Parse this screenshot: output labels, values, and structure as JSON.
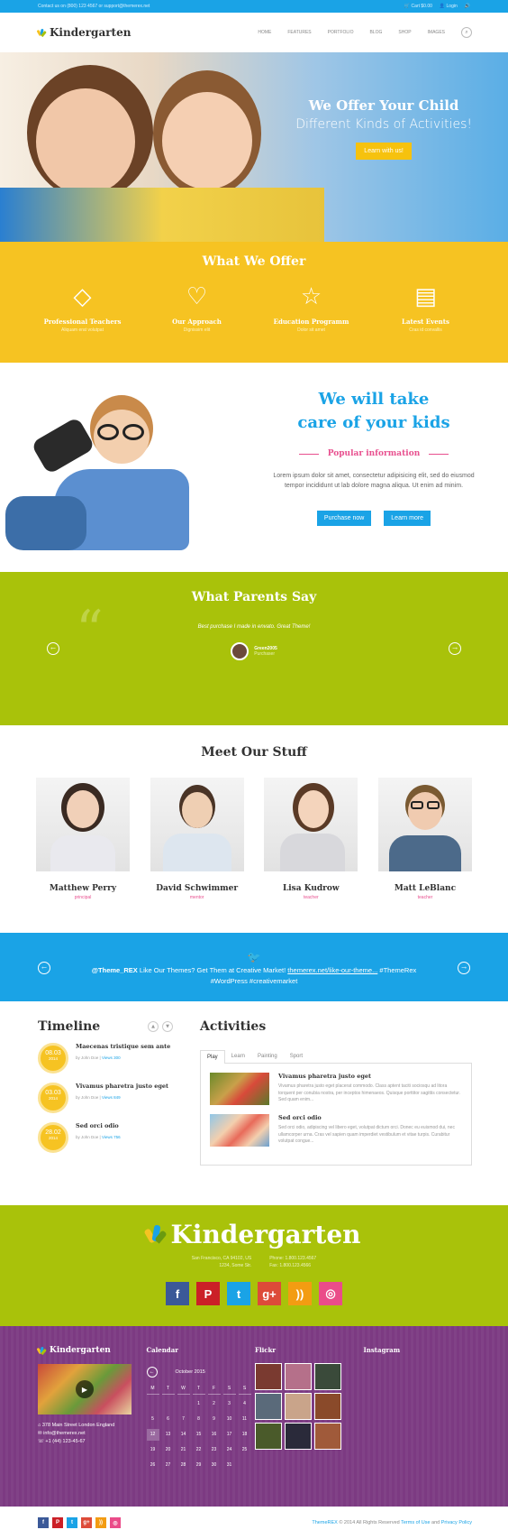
{
  "topbar": {
    "contact": "Contact us on (800) 123 4567 or support@themerex.net",
    "cart": "Cart $0.00",
    "login": "Login"
  },
  "header": {
    "logo": "Kindergarten",
    "nav": [
      "HOME",
      "FEATURES",
      "PORTFOLIO",
      "BLOG",
      "SHOP",
      "IMAGES"
    ]
  },
  "hero": {
    "title": "We Offer Your Child",
    "subtitle": "Different Kinds of Activities!",
    "button": "Learn with us!"
  },
  "offer": {
    "title": "What We Offer",
    "items": [
      {
        "icon": "diamond-icon",
        "title": "Professional Teachers",
        "sub": "Aliquam erat volutpat"
      },
      {
        "icon": "heart-icon",
        "title": "Our Approach",
        "sub": "Dignissim elit"
      },
      {
        "icon": "star-icon",
        "title": "Education Programm",
        "sub": "Dolor sit amet"
      },
      {
        "icon": "news-icon",
        "title": "Latest Events",
        "sub": "Cras id convallis"
      }
    ]
  },
  "care": {
    "title1": "We will take",
    "title2": "care of your kids",
    "popular": "Popular information",
    "text": "Lorem ipsum dolor sit amet, consectetur adipisicing elit, sed do eiusmod tempor incididunt ut lab dolore magna aliqua. Ut enim ad minim.",
    "btn_purchase": "Purchase now",
    "btn_learn": "Learn more"
  },
  "parents": {
    "title": "What Parents Say",
    "quote": "Best purchase I made in envato. Great Theme!",
    "author": "Green2005",
    "author_role": "Purchaser"
  },
  "staff": {
    "title": "Meet Our Stuff",
    "members": [
      {
        "name": "Matthew Perry",
        "role": "principal"
      },
      {
        "name": "David Schwimmer",
        "role": "mentor"
      },
      {
        "name": "Lisa Kudrow",
        "role": "teacher"
      },
      {
        "name": "Matt LeBlanc",
        "role": "teacher"
      }
    ]
  },
  "twitter": {
    "handle": "@Theme_REX",
    "text": " Like Our Themes? Get Them at Creative Market! ",
    "link": "themerex.net/like-our-theme...",
    "tags1": " #ThemeRex",
    "tags2": "#WordPress #creativemarket"
  },
  "timeline": {
    "title": "Timeline",
    "items": [
      {
        "day": "08.03",
        "year": "2014",
        "title": "Maecenas tristique sem ante",
        "by": "by John Doe",
        "views": "Views 300"
      },
      {
        "day": "03.03",
        "year": "2014",
        "title": "Vivamus pharetra justo eget",
        "by": "by John Doe",
        "views": "Views 849"
      },
      {
        "day": "28.02",
        "year": "2014",
        "title": "Sed orci odio",
        "by": "by John Doe",
        "views": "Views 756"
      }
    ]
  },
  "activities": {
    "title": "Activities",
    "tabs": [
      "Play",
      "Learn",
      "Painting",
      "Sport"
    ],
    "items": [
      {
        "title": "Vivamus pharetra justo eget",
        "text": "Vivamus pharetra justo eget placerat commodo. Class aptent taciti sociosqu ad litora torquent per conubia nostra, per inceptos himenaeos. Quisque porttitor sagittis consectetur. Sed quam enim..."
      },
      {
        "title": "Sed orci odio",
        "text": "Sed orci odio, adipiscing vel libero eget, volutpat dictum orci. Donec eu euismod dui, nec ullamcorper urna. Cras vel sapien quam imperdiet vestibulum et vitae turpis. Curabitur volutpat congue..."
      }
    ]
  },
  "green_footer": {
    "logo": "Kindergarten",
    "addr1": "San Francisco, CA 94102, US",
    "addr2": "1234, Some Str.",
    "phone": "Phone: 1.800.123.4567",
    "fax": "Fax: 1.800.123.4566",
    "socials": [
      {
        "icon": "facebook-icon",
        "glyph": "f",
        "color": "#3b5998"
      },
      {
        "icon": "pinterest-icon",
        "glyph": "P",
        "color": "#cb2027"
      },
      {
        "icon": "twitter-icon",
        "glyph": "t",
        "color": "#1aa3e6"
      },
      {
        "icon": "googleplus-icon",
        "glyph": "g+",
        "color": "#dd4b39"
      },
      {
        "icon": "rss-icon",
        "glyph": "))",
        "color": "#f39c12"
      },
      {
        "icon": "dribbble-icon",
        "glyph": "◎",
        "color": "#ea4c89"
      }
    ]
  },
  "footer": {
    "logo": "Kindergarten",
    "address": "378 Main Street London England",
    "email": "info@themerex.net",
    "phone": "+1 (44) 123-45-67",
    "calendar_title": "Calendar",
    "month": "October 2015",
    "weekdays": [
      "M",
      "T",
      "W",
      "T",
      "F",
      "S",
      "S"
    ],
    "days": [
      "",
      "",
      "",
      "1",
      "2",
      "3",
      "4",
      "5",
      "6",
      "7",
      "8",
      "9",
      "10",
      "11",
      "12",
      "13",
      "14",
      "15",
      "16",
      "17",
      "18",
      "19",
      "20",
      "21",
      "22",
      "23",
      "24",
      "25",
      "26",
      "27",
      "28",
      "29",
      "30",
      "31"
    ],
    "today": "12",
    "flickr_title": "Flickr",
    "instagram_title": "Instagram"
  },
  "bottom": {
    "copyright_brand": "ThemeREX",
    "copyright": " © 2014 All Rights Reserved ",
    "terms": "Terms of Use",
    "and": " and ",
    "privacy": "Privacy Policy"
  },
  "colors": {
    "blue": "#1aa3e6",
    "yellow": "#f6c322",
    "green": "#a9c20a",
    "purple": "#7c3a82",
    "pink": "#e8508f"
  }
}
